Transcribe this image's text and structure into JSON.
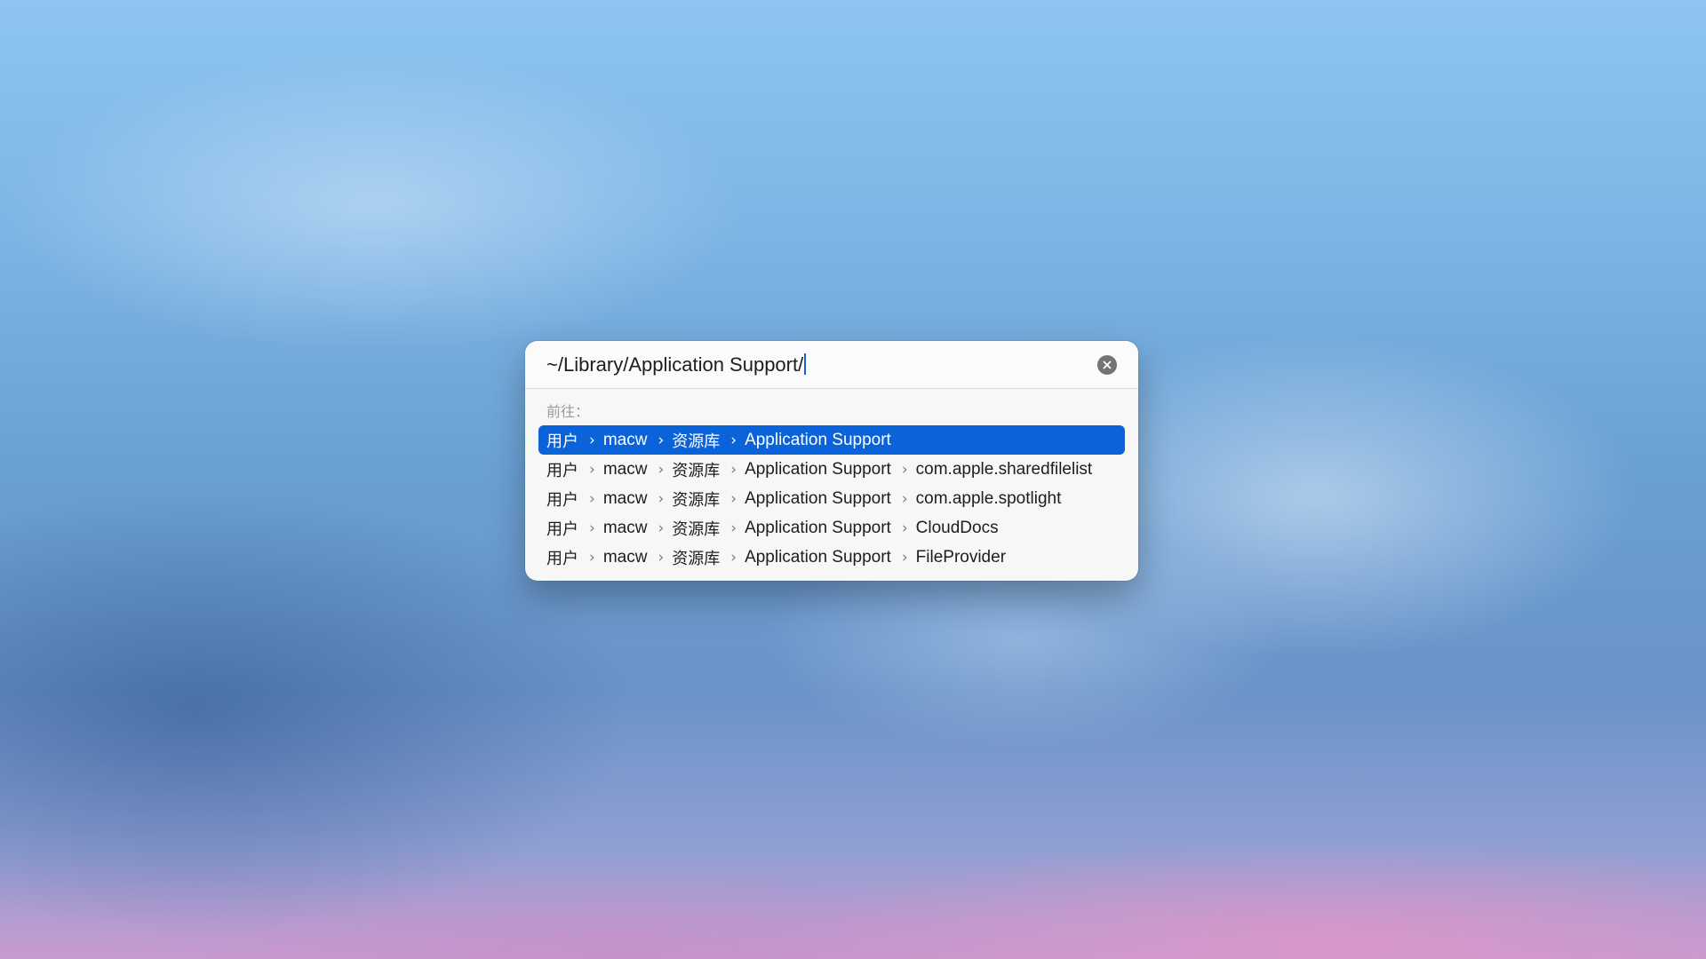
{
  "goto_panel": {
    "path_value": "~/Library/Application Support/",
    "section_label": "前往：",
    "results": [
      {
        "segments": [
          "用户",
          "macw",
          "资源库",
          "Application Support"
        ],
        "selected": true
      },
      {
        "segments": [
          "用户",
          "macw",
          "资源库",
          "Application Support",
          "com.apple.sharedfilelist"
        ],
        "selected": false
      },
      {
        "segments": [
          "用户",
          "macw",
          "资源库",
          "Application Support",
          "com.apple.spotlight"
        ],
        "selected": false
      },
      {
        "segments": [
          "用户",
          "macw",
          "资源库",
          "Application Support",
          "CloudDocs"
        ],
        "selected": false
      },
      {
        "segments": [
          "用户",
          "macw",
          "资源库",
          "Application Support",
          "FileProvider"
        ],
        "selected": false
      }
    ],
    "separator": "›"
  },
  "colors": {
    "selection": "#0b63d9",
    "panel_background": "#f7f7f8",
    "caret": "#1463d8"
  },
  "icons": {
    "clear": "clear-circle-x-icon"
  }
}
